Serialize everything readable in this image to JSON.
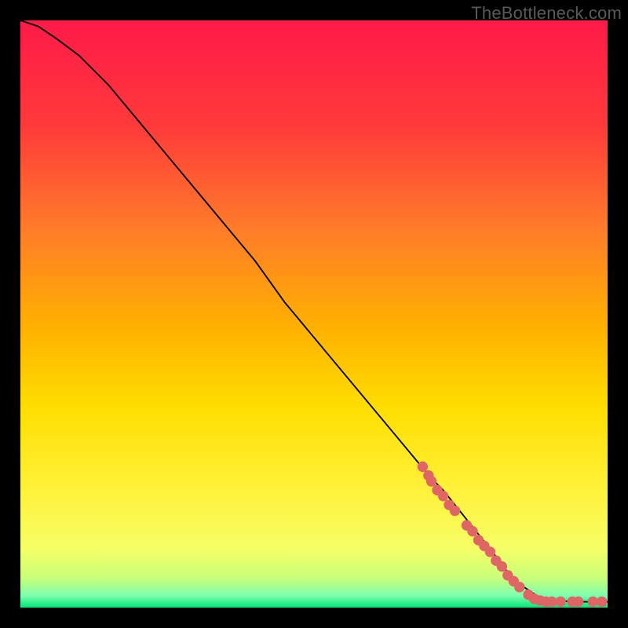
{
  "watermark": "TheBottleneck.com",
  "chart_data": {
    "type": "line",
    "title": "",
    "xlabel": "",
    "ylabel": "",
    "xlim": [
      0,
      100
    ],
    "ylim": [
      0,
      100
    ],
    "grid": false,
    "background_gradient": {
      "top_color": "#ff1a48",
      "mid_upper": "#ff6a2a",
      "mid": "#ffd400",
      "mid_lower": "#ffee55",
      "near_bottom": "#d9ff66",
      "bottom_color": "#00e676"
    },
    "series": [
      {
        "name": "bottleneck-curve",
        "stroke": "#000000",
        "x": [
          0,
          3,
          6,
          10,
          15,
          20,
          25,
          30,
          35,
          40,
          45,
          50,
          55,
          60,
          65,
          70,
          72,
          76,
          80,
          83,
          85,
          88,
          90,
          92,
          94,
          96,
          98,
          100
        ],
        "y": [
          100,
          99,
          97,
          94,
          89,
          83,
          77,
          71,
          65,
          59,
          52,
          46,
          40,
          34,
          28,
          22,
          20,
          15,
          10,
          6,
          4,
          2,
          1.5,
          1.2,
          1.0,
          1.0,
          1.0,
          1.0
        ]
      },
      {
        "name": "highlight-points",
        "marker_color": "#e06666",
        "points": [
          {
            "x": 68.5,
            "y": 24.0
          },
          {
            "x": 69.5,
            "y": 22.5
          },
          {
            "x": 70.0,
            "y": 21.5
          },
          {
            "x": 71.0,
            "y": 20.0
          },
          {
            "x": 72.0,
            "y": 19.0
          },
          {
            "x": 73.0,
            "y": 17.5
          },
          {
            "x": 74.0,
            "y": 16.5
          },
          {
            "x": 76.0,
            "y": 14.0
          },
          {
            "x": 77.0,
            "y": 13.0
          },
          {
            "x": 78.0,
            "y": 11.5
          },
          {
            "x": 79.0,
            "y": 10.5
          },
          {
            "x": 80.0,
            "y": 9.5
          },
          {
            "x": 81.0,
            "y": 8.0
          },
          {
            "x": 82.0,
            "y": 7.0
          },
          {
            "x": 83.0,
            "y": 5.5
          },
          {
            "x": 84.0,
            "y": 4.5
          },
          {
            "x": 85.0,
            "y": 3.5
          },
          {
            "x": 86.5,
            "y": 2.2
          },
          {
            "x": 87.5,
            "y": 1.5
          },
          {
            "x": 88.5,
            "y": 1.2
          },
          {
            "x": 89.5,
            "y": 1.0
          },
          {
            "x": 90.5,
            "y": 1.0
          },
          {
            "x": 92.0,
            "y": 1.0
          },
          {
            "x": 94.0,
            "y": 1.0
          },
          {
            "x": 95.0,
            "y": 1.0
          },
          {
            "x": 97.5,
            "y": 1.0
          },
          {
            "x": 99.0,
            "y": 1.0
          }
        ]
      }
    ]
  }
}
